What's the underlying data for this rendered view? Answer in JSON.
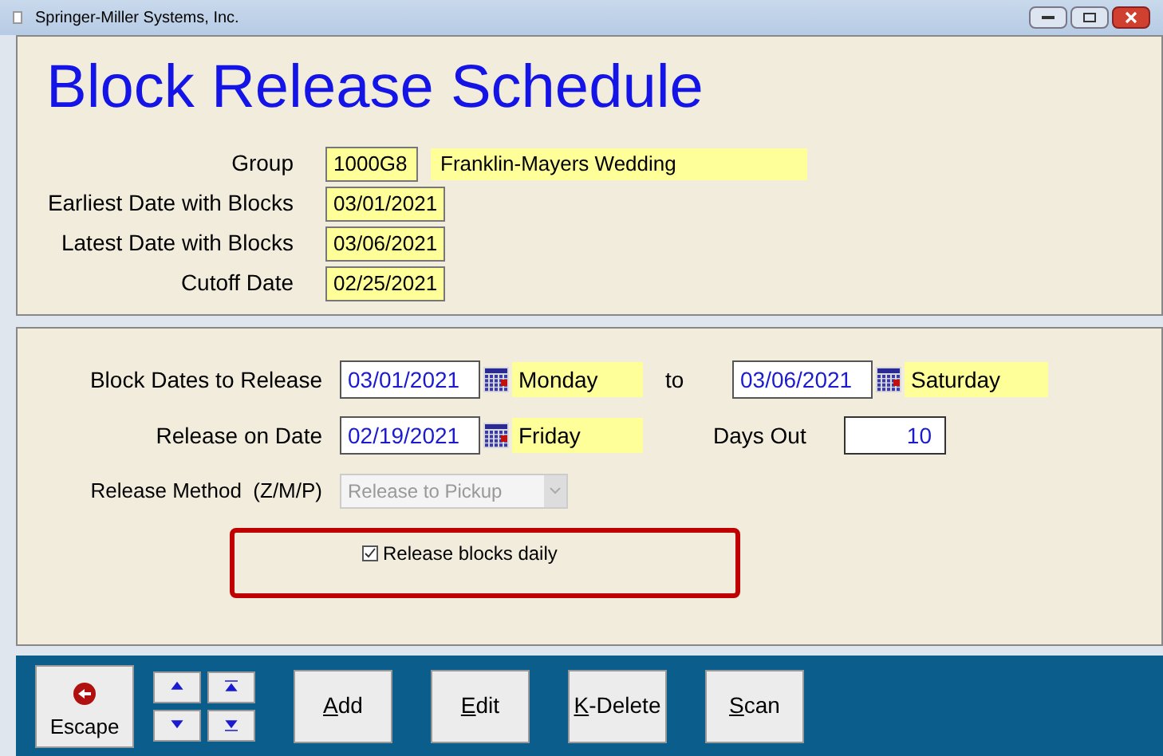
{
  "window": {
    "title": "Springer-Miller Systems, Inc."
  },
  "heading": "Block Release Schedule",
  "group_info": [
    {
      "label": "Group",
      "value": "1000G8",
      "name": "Franklin-Mayers Wedding"
    },
    {
      "label": "Earliest Date with Blocks",
      "value": "03/01/2021"
    },
    {
      "label": "Latest Date with Blocks",
      "value": "03/06/2021"
    },
    {
      "label": "Cutoff Date",
      "value": "02/25/2021"
    }
  ],
  "block_dates": {
    "label": "Block Dates to Release",
    "from": "03/01/2021",
    "from_day": "Monday",
    "to_label": "to",
    "to": "03/06/2021",
    "to_day": "Saturday"
  },
  "release_on": {
    "label": "Release on Date",
    "date": "02/19/2021",
    "day": "Friday",
    "days_out_label": "Days Out",
    "days_out": "10"
  },
  "release_method": {
    "label": "Release Method  (Z/M/P)",
    "value": "Release to Pickup",
    "disabled": true
  },
  "release_daily": {
    "label": "Release blocks daily",
    "checked": true
  },
  "toolbar": [
    {
      "hotkey": "A",
      "rest": "dd"
    },
    {
      "hotkey": "E",
      "rest": "dit"
    },
    {
      "hotkey": "K",
      "rest": "-Delete"
    },
    {
      "hotkey": "S",
      "rest": "can"
    }
  ],
  "escape": {
    "label": "Escape"
  }
}
